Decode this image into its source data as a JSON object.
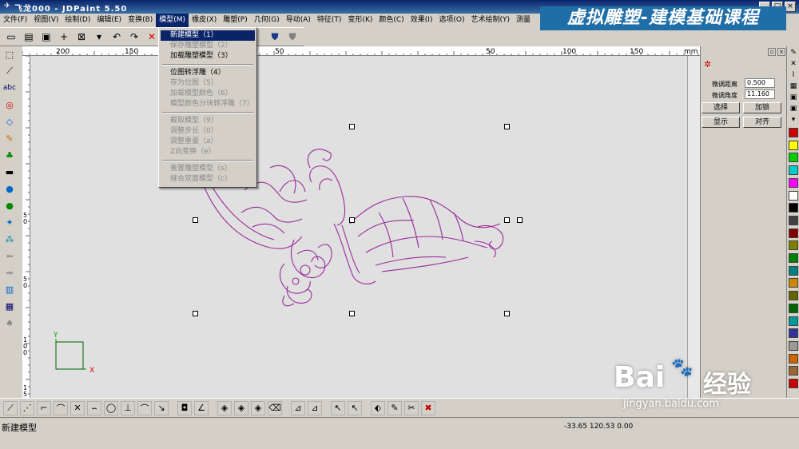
{
  "window": {
    "title": "飞龙000 - JDPaint 5.50"
  },
  "banner": {
    "text": "虚拟雕塑-建模基础课程"
  },
  "menubar": [
    "文件(F)",
    "视图(V)",
    "绘制(D)",
    "编辑(E)",
    "变换(B)",
    "模型(M)",
    "橡皮(X)",
    "雕塑(P)",
    "几何(G)",
    "导动(A)",
    "特征(T)",
    "变形(K)",
    "颜色(C)",
    "效果(I)",
    "选项(O)",
    "艺术绘制(Y)",
    "测量"
  ],
  "dropdown": {
    "items": [
      {
        "label": "新建模型（1）",
        "state": "selected"
      },
      {
        "label": "保存雕塑模型（2）",
        "state": "disabled"
      },
      {
        "label": "加载雕塑模型（3）",
        "state": "enabled"
      },
      {
        "label": "位图转浮雕（4）",
        "state": "enabled"
      },
      {
        "label": "存为位图（5）",
        "state": "disabled"
      },
      {
        "label": "加载模型颜色（6）",
        "state": "disabled"
      },
      {
        "label": "模型颜色分块转浮雕（7）",
        "state": "disabled"
      },
      {
        "label": "截取模型（9）",
        "state": "disabled"
      },
      {
        "label": "调整步长（0）",
        "state": "disabled"
      },
      {
        "label": "调整重量（a）",
        "state": "disabled"
      },
      {
        "label": "Z向变换（e）",
        "state": "disabled"
      },
      {
        "label": "重置雕塑模型（s）",
        "state": "disabled"
      },
      {
        "label": "缝合双面模型（c）",
        "state": "disabled"
      }
    ]
  },
  "ruler": {
    "top_labels": [
      "200",
      "150",
      "100",
      "50",
      "50",
      "100",
      "150",
      "200"
    ],
    "unit": "mm",
    "left_labels": [
      "5",
      "0",
      "5",
      "0",
      "1",
      "0",
      "0",
      "1",
      "5",
      "0"
    ]
  },
  "panel": {
    "fields": [
      {
        "label": "微调距离",
        "value": "0.500"
      },
      {
        "label": "微调角度",
        "value": "11.160"
      }
    ],
    "buttons": [
      "选择",
      "加锁",
      "显示",
      "对齐"
    ]
  },
  "palette": [
    "#cc0000",
    "#ffff00",
    "#00cc00",
    "#00cccc",
    "#ff00ff",
    "#ffffff",
    "#000000",
    "#404040",
    "#800000",
    "#808000",
    "#008000",
    "#008080",
    "#cc8800",
    "#666600",
    "#006600",
    "#009999",
    "#333399",
    "#999999",
    "#cc6600",
    "#996633",
    "#cc0000",
    "#ff6600",
    "#ffcc00",
    "#99cc00",
    "#00cc99",
    "#3399cc",
    "#6666cc",
    "#cc66cc",
    "#999966",
    "#336633",
    "#006666",
    "#669999",
    "#cc9999",
    "#996666",
    "#999999"
  ],
  "axis": {
    "x": "X",
    "y": "Y"
  },
  "status": {
    "text": "新建模型",
    "coords": "-33.65 120.53 0.00"
  },
  "watermark": {
    "brand": "Bai",
    "brand2": "经验",
    "url": "jingyan.baidu.com"
  },
  "colors": {
    "drawing": "#9a2a9a",
    "title_bar": "#0a246a",
    "banner": "#1f6ea8"
  }
}
